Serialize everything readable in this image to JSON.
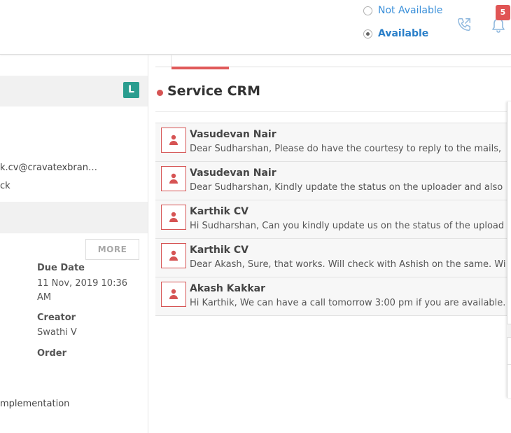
{
  "header": {
    "status_options": [
      {
        "label": "Not Available",
        "selected": false
      },
      {
        "label": "Available",
        "selected": true
      }
    ],
    "notification_count": "5"
  },
  "left_panel": {
    "badge_letter": "L",
    "email_fragment": "k.cv@cravatexbran…",
    "text_fragment": "ck",
    "more_label": "MORE",
    "due_date_label": "Due Date",
    "due_date_value": "11 Nov, 2019 10:36 AM",
    "creator_label": "Creator",
    "creator_value": "Swathi V",
    "order_label": "Order",
    "implementation_fragment": "mplementation"
  },
  "section": {
    "title": "Service CRM"
  },
  "messages": [
    {
      "name": "Vasudevan Nair",
      "text": "Dear Sudharshan, Please do have the courtesy to reply to the mails,"
    },
    {
      "name": "Vasudevan Nair",
      "text": "Dear Sudharshan,  Kindly update the status on the uploader and also"
    },
    {
      "name": "Karthik CV",
      "text": "Hi Sudharshan, Can you kindly update us on the status of the upload"
    },
    {
      "name": "Karthik CV",
      "text": "Dear Akash, Sure, that works. Will check with Ashish on the same. Wi"
    },
    {
      "name": "Akash Kakkar",
      "text": "Hi Karthik, We can have a call tomorrow 3:00 pm if you are available."
    }
  ],
  "colors": {
    "accent_red": "#d65454",
    "link_blue": "#3a8fd9",
    "badge_teal": "#2a9d8f"
  },
  "icons": [
    "radio-unchecked-icon",
    "radio-checked-icon",
    "phone-icon",
    "bell-icon",
    "user-avatar-icon"
  ]
}
